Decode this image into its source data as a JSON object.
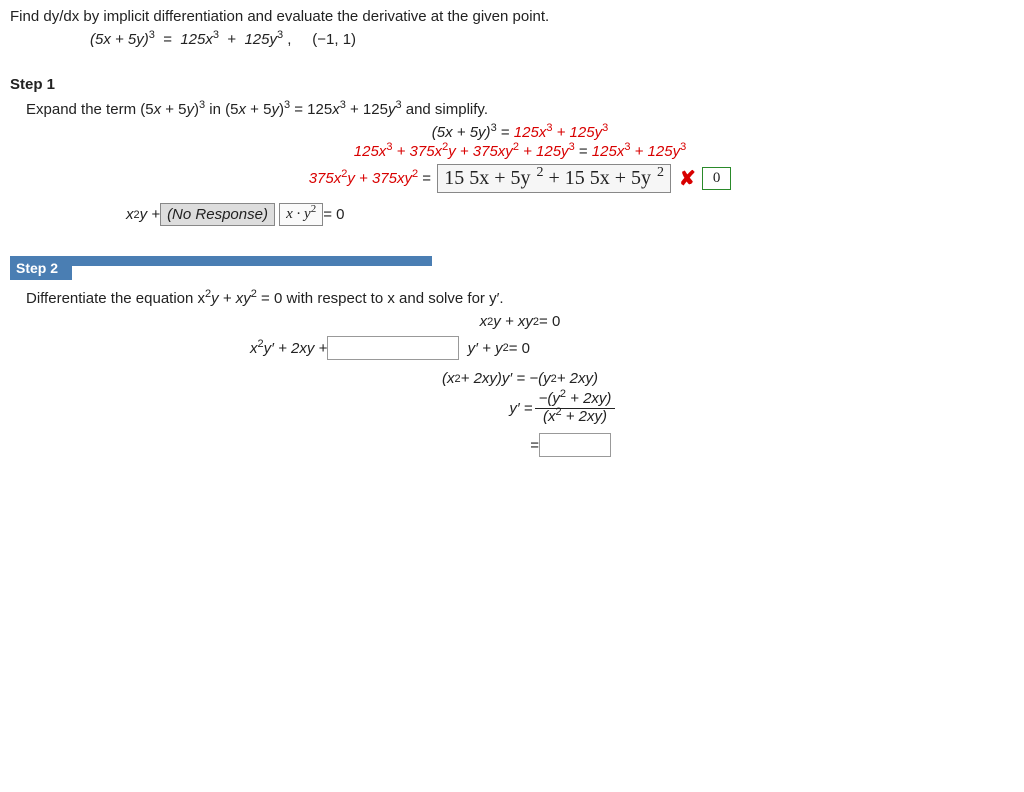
{
  "problem": {
    "prompt": "Find dy/dx by implicit differentiation and evaluate the derivative at the given point.",
    "equation_lhs": "(5x + 5y)",
    "equation_rhs": "125x",
    "equation_rhs2": "125y",
    "point": "(−1, 1)"
  },
  "step1": {
    "label": "Step 1",
    "instruction_a": "Expand the term  (5",
    "instruction_b": " + 5",
    "instruction_c": ")",
    "instruction_d": "  in  (5",
    "instruction_e": " = 125",
    "instruction_f": " + 125",
    "instruction_g": "  and simplify.",
    "line1_lhs": "(5x + 5y)",
    "line1_rhs_a": "125x",
    "line1_rhs_b": " + 125y",
    "line2_lhs": "125x",
    "line2_t2": " + 375x",
    "line2_t3": "y + 375xy",
    "line2_t4": " + 125y",
    "line3_lhs_a": "375x",
    "line3_lhs_b": "y + 375xy",
    "wrong_answer_a": "15  5x + 5y",
    "wrong_answer_b": " + 15  5x + 5y",
    "zero_hint": "0",
    "line4_lhs": "x",
    "line4_lhsb": "y + ",
    "no_response": "(No Response)",
    "small_box_expr": "x · y",
    "eq_zero": " = 0"
  },
  "step2": {
    "label": "Step 2",
    "instruction": "Differentiate the equation  x",
    "instruction_b": "y + xy",
    "instruction_c": " = 0  with respect to x and solve for y′.",
    "eq1_l": "x",
    "eq1_m": "y + xy",
    "eq1_r": " = 0",
    "eq2_l": "x",
    "eq2_m": "y′ + 2xy + ",
    "eq2_r_a": "y′ + y",
    "eq2_r_b": " = 0",
    "eq3_l": "(x",
    "eq3_m": " + 2xy)y′ = −(y",
    "eq3_r": " + 2xy)",
    "eq4_l": "y′ = ",
    "frac_num_a": "−(y",
    "frac_num_b": " + 2xy)",
    "frac_den_a": "(x",
    "frac_den_b": " + 2xy)",
    "eq5_l": "= "
  }
}
